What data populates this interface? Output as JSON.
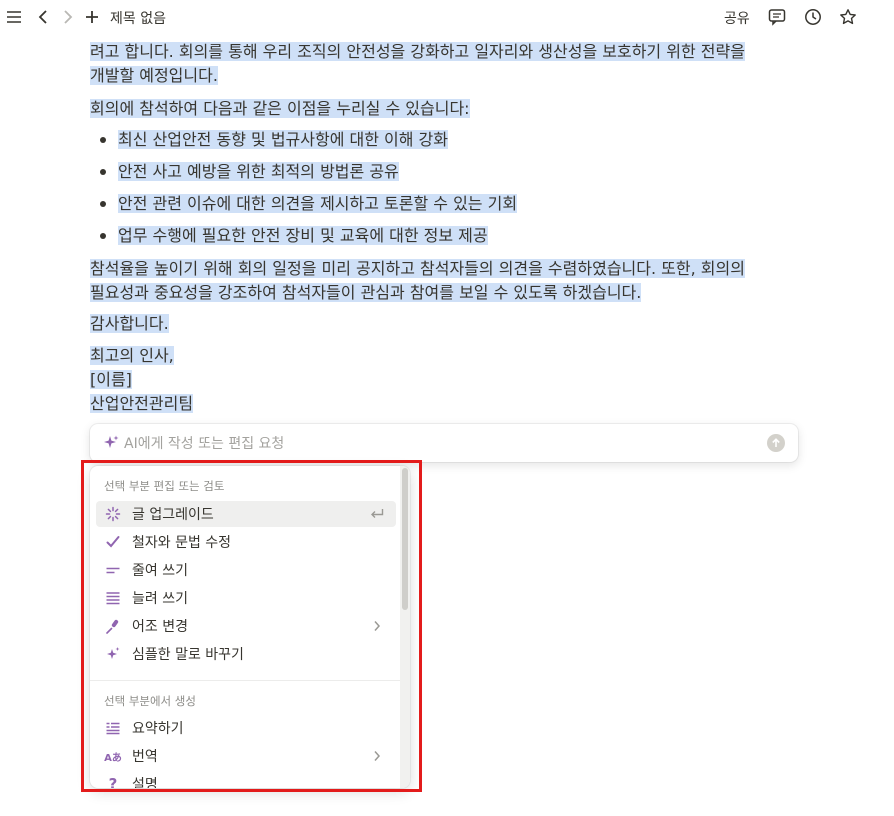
{
  "topbar": {
    "title": "제목 없음",
    "share_label": "공유"
  },
  "document": {
    "para1_line1": "려고 합니다. 회의를 통해 우리 조직의 안전성을 강화하고 일자리와 생산성을 보호하기 위한 전략을",
    "para1_line2": "개발할 예정입니다.",
    "para2": "회의에 참석하여 다음과 같은 이점을 누리실 수 있습니다:",
    "bullets": [
      "최신 산업안전 동향 및 법규사항에 대한 이해 강화",
      "안전 사고 예방을 위한 최적의 방법론 공유",
      "안전 관련 이슈에 대한 의견을 제시하고 토론할 수 있는 기회",
      "업무 수행에 필요한 안전 장비 및 교육에 대한 정보 제공"
    ],
    "para3_line1": "참석율을 높이기 위해 회의 일정을 미리 공지하고 참석자들의 의견을 수렴하였습니다. 또한, 회의의",
    "para3_line2": "필요성과 중요성을 강조하여 참석자들이 관심과 참여를 보일 수 있도록 하겠습니다.",
    "thanks": "감사합니다.",
    "closing": "최고의 인사,",
    "name": "[이름]",
    "team": "산업안전관리팀"
  },
  "ai_bar": {
    "placeholder": "AI에게 작성 또는 편집 요청"
  },
  "menu": {
    "section1_title": "선택 부분 편집 또는 검토",
    "section1_items": [
      {
        "label": "글 업그레이드",
        "icon": "sparkle-burst-icon"
      },
      {
        "label": "철자와 문법 수정",
        "icon": "check-icon"
      },
      {
        "label": "줄여 쓰기",
        "icon": "short-lines-icon"
      },
      {
        "label": "늘려 쓰기",
        "icon": "long-lines-icon"
      },
      {
        "label": "어조 변경",
        "icon": "mic-icon"
      },
      {
        "label": "심플한 말로 바꾸기",
        "icon": "sparkles-icon"
      }
    ],
    "section2_title": "선택 부분에서 생성",
    "section2_items": [
      {
        "label": "요약하기",
        "icon": "summary-icon"
      },
      {
        "label": "번역",
        "icon": "translate-icon"
      },
      {
        "label": "설명",
        "icon": "question-icon"
      }
    ],
    "translate_glyph": "Aあ",
    "question_glyph": "?"
  },
  "colors": {
    "selection": "#cfe0f7",
    "accent_purple": "#9065b0",
    "highlight_box": "#e31b1b"
  }
}
